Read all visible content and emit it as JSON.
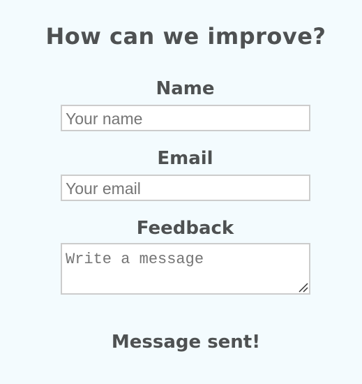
{
  "page": {
    "background": "#f3fbfe",
    "text_color": "#4e5152"
  },
  "form": {
    "title": "How can we improve?",
    "name": {
      "label": "Name",
      "placeholder": "Your name",
      "value": ""
    },
    "email": {
      "label": "Email",
      "placeholder": "Your email",
      "value": ""
    },
    "feedback": {
      "label": "Feedback",
      "placeholder": "Write a message",
      "value": ""
    },
    "status_message": "Message sent!"
  },
  "icons": {
    "resize_grip": "resize-grip-icon"
  }
}
